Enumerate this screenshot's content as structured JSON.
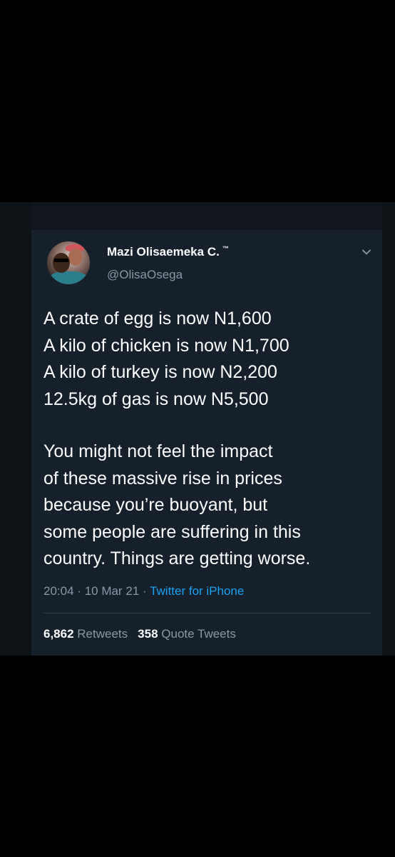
{
  "tweet": {
    "display_name": "Mazi Olisaemeka C.",
    "trademark": "™",
    "handle": "@OlisaOsega",
    "lines": [
      "A crate of egg is now N1,600",
      "A kilo of chicken is now N1,700",
      "A kilo of turkey is now N2,200",
      "12.5kg of gas is now N5,500"
    ],
    "paragraph_lines": [
      "You might not feel the impact",
      "of these massive rise in prices",
      "because you’re buoyant, but",
      "some people are suffering in this",
      "country. Things are getting worse."
    ],
    "time": "20:04",
    "date": "10 Mar 21",
    "source": "Twitter for iPhone",
    "separator": "·",
    "retweets_count": "6,862",
    "retweets_label": "Retweets",
    "quote_count": "358",
    "quote_label": "Quote Tweets"
  },
  "icons": {
    "menu": "chevron-down-icon"
  },
  "colors": {
    "background": "#15202b",
    "link": "#1da1f2",
    "muted": "#8899a6",
    "text": "#ffffff"
  }
}
